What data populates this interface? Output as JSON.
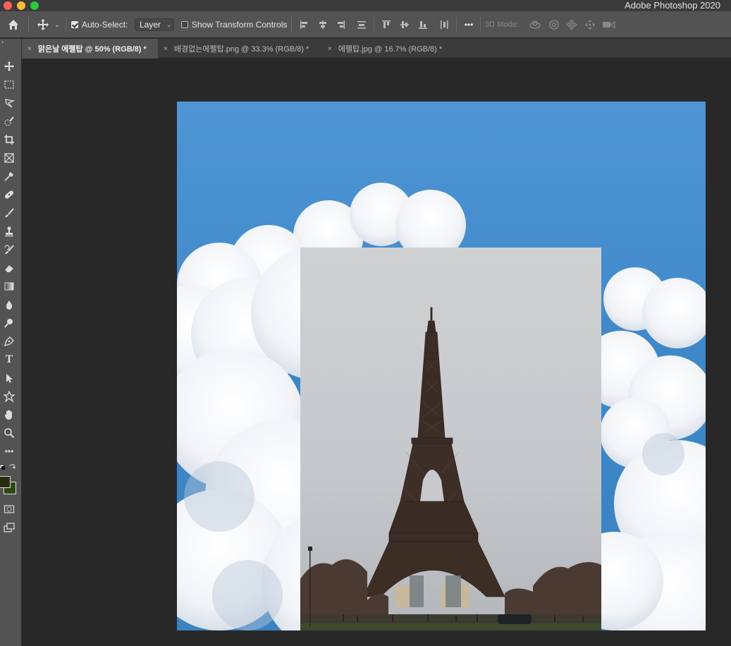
{
  "app": {
    "title": "Adobe Photoshop 2020"
  },
  "options_bar": {
    "auto_select_label": "Auto-Select:",
    "auto_select_checked": true,
    "auto_select_target": "Layer",
    "show_transform_label": "Show Transform Controls",
    "show_transform_checked": false,
    "more_label": "•••",
    "mode_3d_label": "3D Mode:"
  },
  "tabs": [
    {
      "label": "맑은날 에펠탑 @ 50% (RGB/8) *",
      "active": true
    },
    {
      "label": "배경없는에펠탑.png @ 33.3% (RGB/8) *",
      "active": false
    },
    {
      "label": "에펠탑.jpg @ 16.7% (RGB/8) *",
      "active": false
    }
  ],
  "tabs_close_glyph": "×",
  "toolbar": {
    "more_label": "•••",
    "foreground_color": "#2b2a13",
    "background_color": "#2c4a10",
    "tools": [
      "move-tool",
      "rectangular-marquee-tool",
      "lasso-tool",
      "quick-selection-tool",
      "crop-tool",
      "frame-tool",
      "eyedropper-tool",
      "healing-brush-tool",
      "brush-tool",
      "clone-stamp-tool",
      "history-brush-tool",
      "eraser-tool",
      "gradient-tool",
      "blur-tool",
      "dodge-tool",
      "pen-tool",
      "type-tool",
      "path-selection-tool",
      "custom-shape-tool",
      "hand-tool",
      "zoom-tool",
      "edit-toolbar",
      "quick-mask-mode",
      "screen-mode"
    ]
  },
  "colors": {
    "sky": "#4b93d2",
    "panel": "#535353",
    "workspace": "#282828"
  }
}
